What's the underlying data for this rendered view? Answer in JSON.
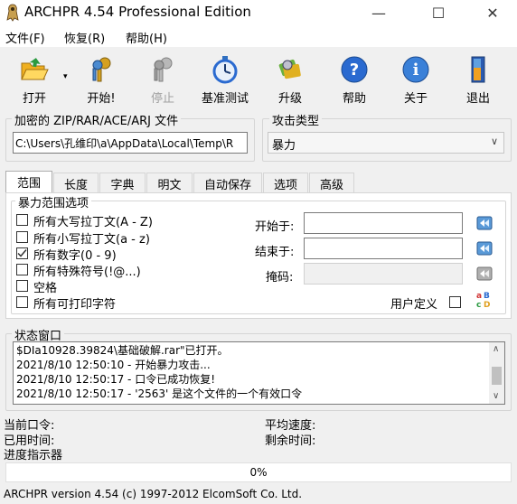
{
  "window": {
    "title": "ARCHPR 4.54 Professional Edition",
    "minimize": "—",
    "maximize": "☐",
    "close": "✕"
  },
  "menu": [
    "文件(F)",
    "恢复(R)",
    "帮助(H)"
  ],
  "toolbar": {
    "open": "打开",
    "start": "开始!",
    "stop": "停止",
    "benchmark": "基准测试",
    "upgrade": "升级",
    "help": "帮助",
    "about": "关于",
    "exit": "退出"
  },
  "file_group": {
    "label": "加密的 ZIP/RAR/ACE/ARJ 文件",
    "path": "C:\\Users\\孔维印\\a\\AppData\\Local\\Temp\\R"
  },
  "attack_group": {
    "label": "攻击类型",
    "selected": "暴力"
  },
  "tabs": [
    "范围",
    "长度",
    "字典",
    "明文",
    "自动保存",
    "选项",
    "高级"
  ],
  "range": {
    "group_label": "暴力范围选项",
    "options": [
      {
        "label": "所有大写拉丁文(A - Z)",
        "checked": false
      },
      {
        "label": "所有小写拉丁文(a - z)",
        "checked": false
      },
      {
        "label": "所有数字(0 - 9)",
        "checked": true
      },
      {
        "label": "所有特殊符号(!@...)",
        "checked": false
      },
      {
        "label": "空格",
        "checked": false
      },
      {
        "label": "所有可打印字符",
        "checked": false
      }
    ],
    "start_label": "开始于:",
    "end_label": "结束于:",
    "mask_label": "掩码:",
    "user_defined_label": "用户定义"
  },
  "status": {
    "label": "状态窗口",
    "lines": [
      "$DIa10928.39824\\基础破解.rar\"已打开。",
      "2021/8/10 12:50:10 - 开始暴力攻击...",
      "2021/8/10 12:50:17 - 口令已成功恢复!",
      "2021/8/10 12:50:17 - '2563' 是这个文件的一个有效口令"
    ]
  },
  "info": {
    "current_password": "当前口令:",
    "elapsed": "已用时间:",
    "progress_indicator": "进度指示器",
    "avg_speed": "平均速度:",
    "remaining": "剩余时间:"
  },
  "progress": {
    "value": 0,
    "text": "0%"
  },
  "statusbar": "ARCHPR version 4.54 (c) 1997-2012 ElcomSoft Co. Ltd.",
  "colors": {
    "accent": "#2a6ad0",
    "check_mark": "#333333"
  }
}
